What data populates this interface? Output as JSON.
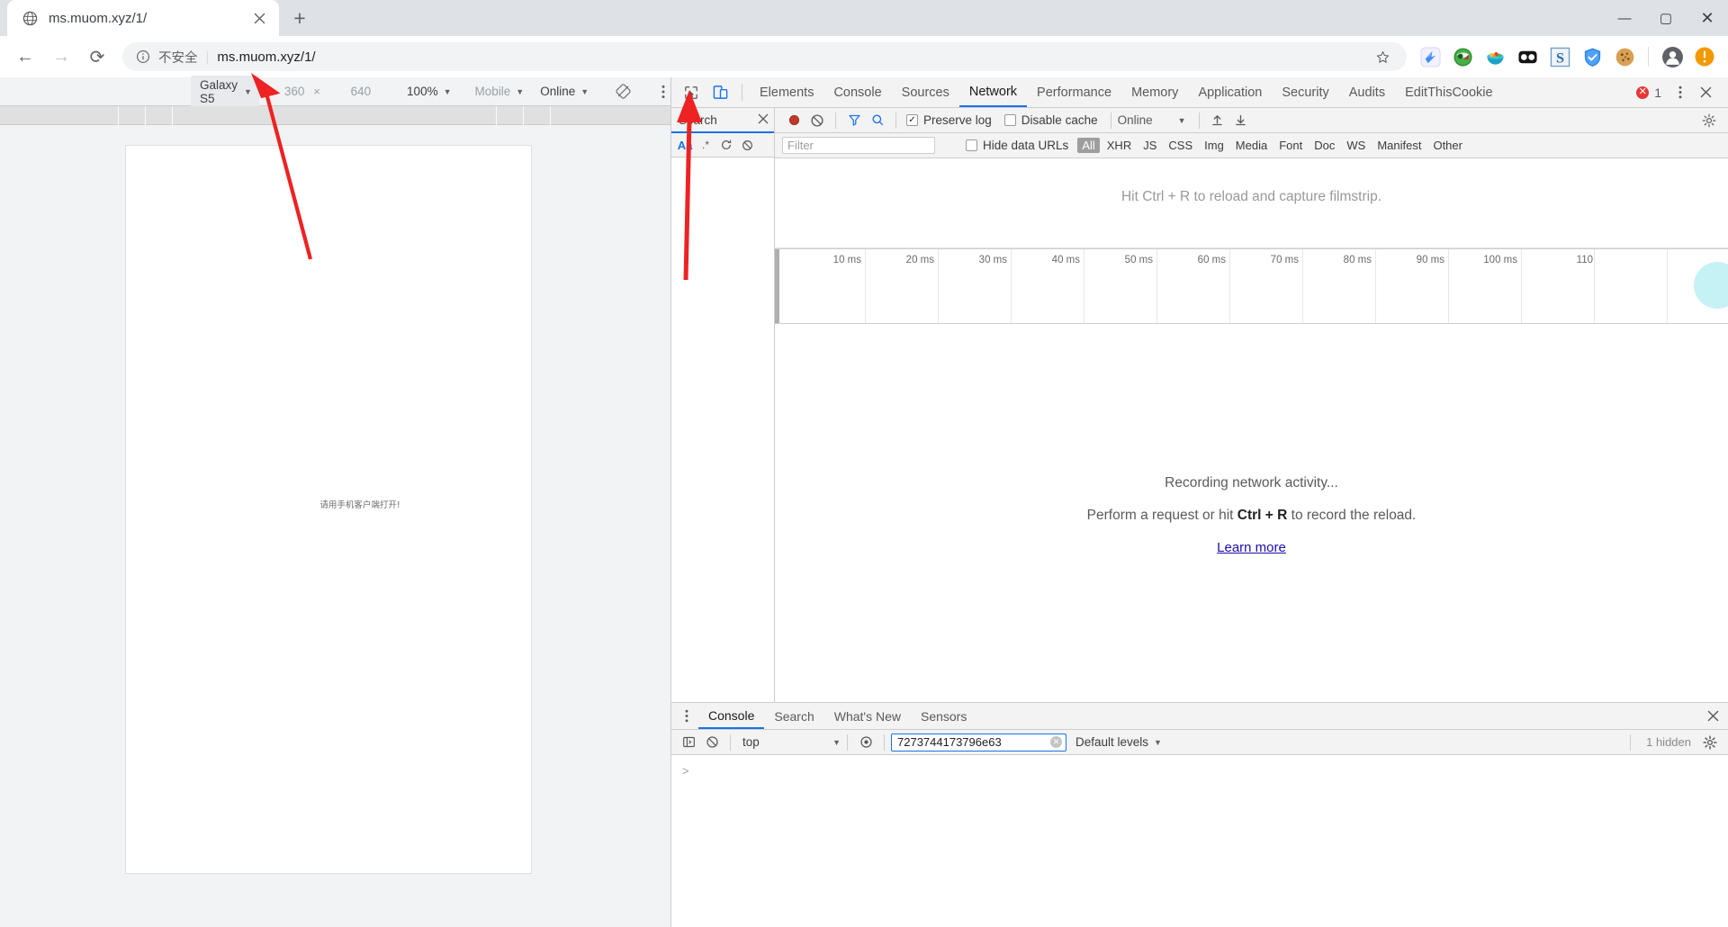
{
  "browser": {
    "tab": {
      "title": "ms.muom.xyz/1/",
      "favicon_icon": "globe-icon",
      "close_icon": "close-icon"
    },
    "newtab_label": "+",
    "window_controls": {
      "minimize": "—",
      "maximize": "▢",
      "close": "✕"
    },
    "nav": {
      "back": "←",
      "forward": "→",
      "reload": "⟳"
    },
    "omnibox": {
      "info_icon": "info-circle-icon",
      "security_label": "不安全",
      "separator": "|",
      "url": "ms.muom.xyz/1/",
      "star_icon": "star-icon"
    },
    "extensions": [
      {
        "name": "kingfisher-extension-icon"
      },
      {
        "name": "idm-extension-icon"
      },
      {
        "name": "bowl-extension-icon"
      },
      {
        "name": "goggles-extension-icon"
      },
      {
        "name": "s-extension-icon"
      },
      {
        "name": "shield-extension-icon"
      },
      {
        "name": "editthiscookie-extension-icon"
      }
    ],
    "profile_icon": "account-avatar-icon",
    "update_icon": "update-alert-icon"
  },
  "device_toolbar": {
    "device": "Galaxy S5",
    "width": "360",
    "x": "×",
    "height": "640",
    "zoom": "100%",
    "throttle_device": "Mobile",
    "throttle_network": "Online",
    "rotate_icon": "rotate-device-icon",
    "menu_icon": "more-vertical-icon"
  },
  "page": {
    "body_text": "请用手机客户端打开!"
  },
  "devtools": {
    "inspect_icon": "inspect-element-icon",
    "device_toggle_icon": "toggle-device-toolbar-icon",
    "tabs": [
      {
        "label": "Elements",
        "active": false
      },
      {
        "label": "Console",
        "active": false
      },
      {
        "label": "Sources",
        "active": false
      },
      {
        "label": "Network",
        "active": true
      },
      {
        "label": "Performance",
        "active": false
      },
      {
        "label": "Memory",
        "active": false
      },
      {
        "label": "Application",
        "active": false
      },
      {
        "label": "Security",
        "active": false
      },
      {
        "label": "Audits",
        "active": false
      },
      {
        "label": "EditThisCookie",
        "active": false
      }
    ],
    "error_count": "1",
    "error_icon": "error-circle-icon",
    "kebab_icon": "more-vertical-icon",
    "close_icon": "close-icon",
    "search_panel": {
      "title": "Search",
      "close_icon": "close-icon",
      "match_case_label": "Aa",
      "regex_label": ".*",
      "refresh_icon": "refresh-icon",
      "clear_icon": "clear-icon"
    },
    "network": {
      "record_icon": "record-stop-icon",
      "clear_icon": "clear-network-icon",
      "filter_icon": "filter-funnel-icon",
      "search_icon": "search-icon",
      "preserve_log_label": "Preserve log",
      "preserve_log_checked": true,
      "disable_cache_label": "Disable cache",
      "disable_cache_checked": false,
      "throttle_value": "Online",
      "import_icon": "import-har-icon",
      "export_icon": "export-har-icon",
      "settings_icon": "gear-icon",
      "filter_placeholder": "Filter",
      "filter_value": "",
      "hide_data_urls_label": "Hide data URLs",
      "hide_data_urls_checked": false,
      "resource_types": [
        "All",
        "XHR",
        "JS",
        "CSS",
        "Img",
        "Media",
        "Font",
        "Doc",
        "WS",
        "Manifest",
        "Other"
      ],
      "active_resource_type": "All",
      "filmstrip_message": "Hit Ctrl + R to reload and capture filmstrip.",
      "overview_ticks": [
        "10 ms",
        "20 ms",
        "30 ms",
        "40 ms",
        "50 ms",
        "60 ms",
        "70 ms",
        "80 ms",
        "90 ms",
        "100 ms",
        "110"
      ],
      "empty_title": "Recording network activity...",
      "empty_sub_pre": "Perform a request or hit ",
      "empty_sub_key": "Ctrl + R",
      "empty_sub_post": " to record the reload.",
      "learn_more": "Learn more"
    },
    "drawer": {
      "kebab_icon": "more-vertical-icon",
      "tabs": [
        {
          "label": "Console",
          "active": true
        },
        {
          "label": "Search",
          "active": false
        },
        {
          "label": "What's New",
          "active": false
        },
        {
          "label": "Sensors",
          "active": false
        }
      ],
      "close_icon": "close-icon",
      "console": {
        "sidebar_icon": "console-sidebar-icon",
        "clear_icon": "clear-console-icon",
        "context": "top",
        "eye_icon": "live-expression-icon",
        "filter_value": "7273744173796e63",
        "filter_clear_icon": "clear-input-icon",
        "levels_label": "Default levels",
        "hidden_label": "1 hidden",
        "settings_icon": "gear-icon",
        "prompt": ">"
      }
    }
  },
  "annotations": {
    "arrow_color": "#ee2222",
    "arrows": [
      {
        "name": "arrow-to-device-dropdown"
      },
      {
        "name": "arrow-to-device-toolbar-toggle"
      }
    ]
  }
}
